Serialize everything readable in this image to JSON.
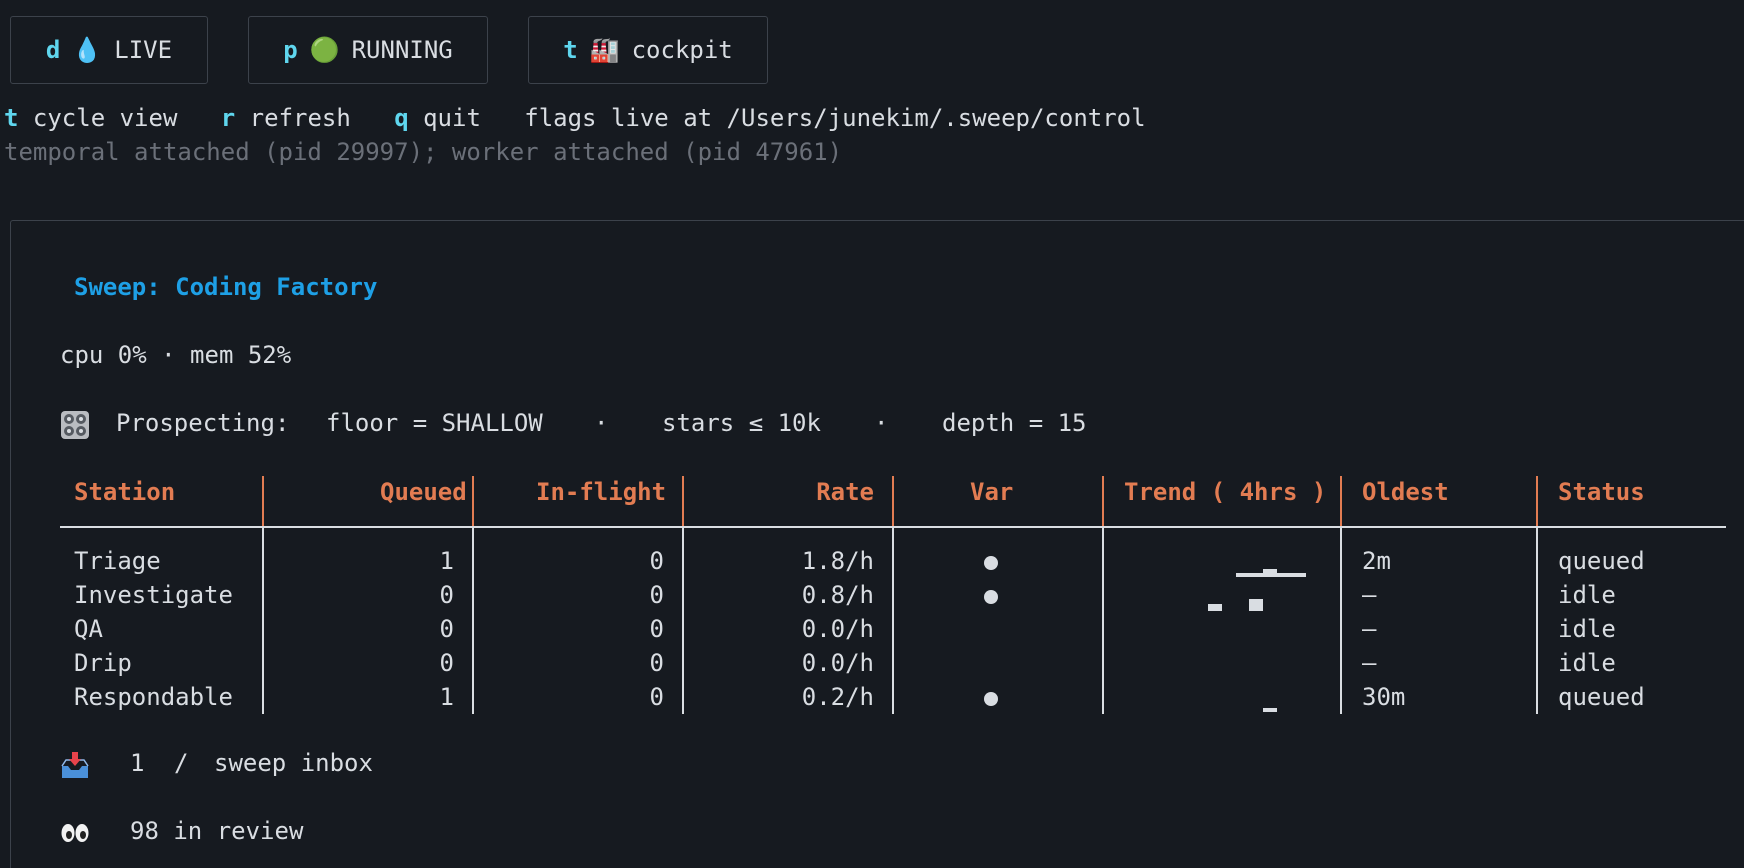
{
  "buttons": [
    {
      "key": "d",
      "icon": "💧",
      "label": "LIVE"
    },
    {
      "key": "p",
      "icon": "🟢",
      "label": "RUNNING"
    },
    {
      "key": "t",
      "icon": "🏭",
      "label": "cockpit"
    }
  ],
  "shortcuts": [
    {
      "key": "t",
      "label": "cycle view"
    },
    {
      "key": "r",
      "label": "refresh"
    },
    {
      "key": "q",
      "label": "quit"
    }
  ],
  "flags_text": "flags live at /Users/junekim/.sweep/control",
  "attach_status": "temporal attached (pid 29997); worker attached (pid 47961)",
  "panel": {
    "title": "Sweep: Coding Factory",
    "resources": "cpu 0% · mem 52%",
    "prospecting": {
      "icon": "control-knobs-icon",
      "label": "Prospecting:",
      "floor": "floor = SHALLOW",
      "sep": "·",
      "stars": "stars ≤ 10k",
      "depth": "depth = 15"
    },
    "table": {
      "headers": {
        "station": "Station",
        "queued": "Queued",
        "inflight": "In-flight",
        "rate": "Rate",
        "var": "Var",
        "trend": "Trend ( 4hrs )",
        "oldest": "Oldest",
        "status": "Status"
      },
      "rows": [
        {
          "station": "Triage",
          "queued": "1",
          "inflight": "0",
          "rate": "1.8/h",
          "var": "●",
          "oldest": "2m",
          "status": "queued"
        },
        {
          "station": "Investigate",
          "queued": "0",
          "inflight": "0",
          "rate": "0.8/h",
          "var": "●",
          "oldest": "–",
          "status": "idle"
        },
        {
          "station": "QA",
          "queued": "0",
          "inflight": "0",
          "rate": "0.0/h",
          "var": "",
          "oldest": "–",
          "status": "idle"
        },
        {
          "station": "Drip",
          "queued": "0",
          "inflight": "0",
          "rate": "0.0/h",
          "var": "",
          "oldest": "–",
          "status": "idle"
        },
        {
          "station": "Respondable",
          "queued": "1",
          "inflight": "0",
          "rate": "0.2/h",
          "var": "●",
          "oldest": "30m",
          "status": "queued"
        }
      ]
    },
    "inbox": {
      "icon": "inbox-tray-icon",
      "count": "1",
      "sep": "/",
      "label": "sweep inbox"
    },
    "review": {
      "icon": "eyes-icon",
      "text": "98 in review"
    }
  },
  "colors": {
    "accent_cyan": "#5fd6ee",
    "title_blue": "#1ea0e6",
    "header_orange": "#e27c52",
    "text": "#d9dde2",
    "dim": "#6b7079",
    "background": "#161a20"
  }
}
